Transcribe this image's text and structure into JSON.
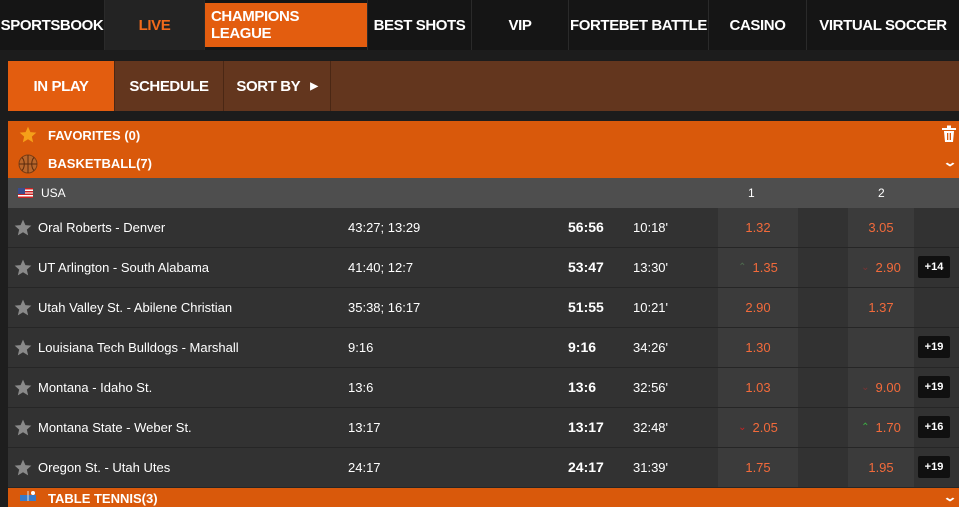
{
  "topnav": [
    {
      "label": "SPORTSBOOK"
    },
    {
      "label": "LIVE"
    },
    {
      "label": "CHAMPIONS LEAGUE"
    },
    {
      "label": "BEST SHOTS"
    },
    {
      "label": "VIP"
    },
    {
      "label": "FORTEBET BATTLE"
    },
    {
      "label": "CASINO"
    },
    {
      "label": "VIRTUAL SOCCER"
    }
  ],
  "subnav": {
    "in_play": "IN PLAY",
    "schedule": "SCHEDULE",
    "sort_by": "SORT BY",
    "sort_arrow": "▶"
  },
  "favorites": {
    "label": "FAVORITES (0)",
    "icon": "star-icon"
  },
  "basketball": {
    "label": "BASKETBALL(7)",
    "icon": "basketball-icon"
  },
  "country": {
    "name": "USA",
    "col1": "1",
    "col2": "2"
  },
  "matches": [
    {
      "name": "Oral Roberts - Denver",
      "score": "43:27; 13:29",
      "total": "56:56",
      "time": "10:18'",
      "odd1": "1.32",
      "odd1_ind": "",
      "odd2": "3.05",
      "odd2_ind": "",
      "more": ""
    },
    {
      "name": "UT Arlington - South Alabama",
      "score": "41:40; 12:7",
      "total": "53:47",
      "time": "13:30'",
      "odd1": "1.35",
      "odd1_ind": "up-dim",
      "odd2": "2.90",
      "odd2_ind": "down-dim",
      "more": "+14"
    },
    {
      "name": "Utah Valley St. - Abilene Christian",
      "score": "35:38; 16:17",
      "total": "51:55",
      "time": "10:21'",
      "odd1": "2.90",
      "odd1_ind": "",
      "odd2": "1.37",
      "odd2_ind": "",
      "more": ""
    },
    {
      "name": "Louisiana Tech Bulldogs - Marshall",
      "score": "9:16",
      "total": "9:16",
      "time": "34:26'",
      "odd1": "1.30",
      "odd1_ind": "",
      "odd2": "",
      "odd2_ind": "",
      "more": "+19"
    },
    {
      "name": "Montana - Idaho St.",
      "score": "13:6",
      "total": "13:6",
      "time": "32:56'",
      "odd1": "1.03",
      "odd1_ind": "",
      "odd2": "9.00",
      "odd2_ind": "down-dim",
      "more": "+19"
    },
    {
      "name": "Montana State - Weber St.",
      "score": "13:17",
      "total": "13:17",
      "time": "32:48'",
      "odd1": "2.05",
      "odd1_ind": "down",
      "odd2": "1.70",
      "odd2_ind": "up",
      "more": "+16"
    },
    {
      "name": "Oregon St. - Utah Utes",
      "score": "24:17",
      "total": "24:17",
      "time": "31:39'",
      "odd1": "1.75",
      "odd1_ind": "",
      "odd2": "1.95",
      "odd2_ind": "",
      "more": "+19"
    }
  ],
  "table_tennis": {
    "label": "TABLE TENNIS(3)",
    "icon": "table-tennis-icon"
  },
  "colors": {
    "accent": "#e35d0f",
    "section": "#d9590b",
    "subnav": "#63361e",
    "odds": "#f26a3b"
  }
}
